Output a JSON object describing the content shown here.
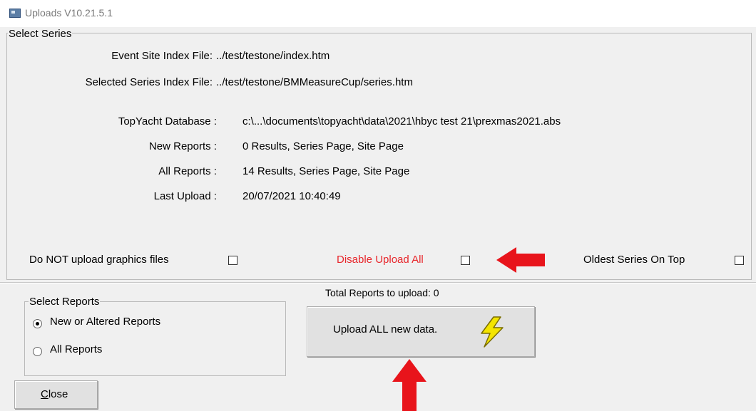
{
  "window": {
    "title": "Uploads V10.21.5.1"
  },
  "select_series": {
    "caption": "Select Series",
    "event_site_label": "Event Site Index File:",
    "event_site_value": "../test/testone/index.htm",
    "selected_series_label": "Selected Series Index File:",
    "selected_series_value": "../test/testone/BMMeasureCup/series.htm",
    "database_label": "TopYacht  Database :",
    "database_value": "c:\\...\\documents\\topyacht\\data\\2021\\hbyc test 21\\prexmas2021.abs",
    "new_reports_label": "New Reports :",
    "new_reports_value": "0 Results, Series Page, Site Page",
    "all_reports_label": "All Reports :",
    "all_reports_value": "14 Results, Series Page, Site Page",
    "last_upload_label": "Last Upload :",
    "last_upload_value": "20/07/2021 10:40:49",
    "no_graphics_label": "Do NOT upload graphics files",
    "disable_upload_label": "Disable Upload All",
    "oldest_on_top_label": "Oldest Series On Top"
  },
  "select_reports": {
    "caption": "Select Reports",
    "options": [
      "New or Altered Reports",
      "All Reports"
    ],
    "selected": "New or Altered Reports"
  },
  "upload": {
    "total_label": "Total Reports to upload: 0",
    "button_label": "Upload ALL new data."
  },
  "close_button": {
    "label": "Close"
  },
  "colors": {
    "warning_text": "#e8262b",
    "arrow": "#e8141b",
    "lightning": "#f4e500"
  }
}
